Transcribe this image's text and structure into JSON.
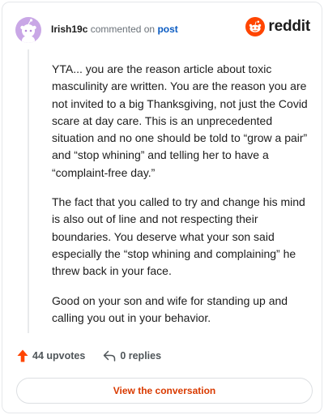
{
  "header": {
    "username": "Irish19c",
    "action_text": "commented on",
    "post_link": "post",
    "logo_text": "reddit"
  },
  "comment": {
    "paragraphs": [
      "YTA... you are the reason article about toxic masculinity are written. You are the reason you are not invited to a big Thanksgiving, not just the Covid scare at day care. This is an unprecedented situation and no one should be told to “grow a pair” and “stop whining” and telling her to have a “complaint-free day.”",
      "The fact that you called to try and change his mind is also out of line and not respecting their boundaries. You deserve what your son said especially the “stop whining and complaining” he threw back in your face.",
      "Good on your son and wife for standing up and calling you out in your behavior."
    ]
  },
  "actions": {
    "upvotes_label": "44 upvotes",
    "replies_label": "0 replies"
  },
  "cta": {
    "label": "View the conversation"
  },
  "colors": {
    "brand": "#ff4500",
    "cta_text": "#d93a00",
    "post_link": "#0a5bc2",
    "avatar_bg": "#c9a7e6"
  },
  "icons": {
    "avatar": "snoo-avatar-icon",
    "logo": "reddit-snoo-icon",
    "upvote": "upvote-arrow-icon",
    "reply": "reply-arrow-icon"
  }
}
